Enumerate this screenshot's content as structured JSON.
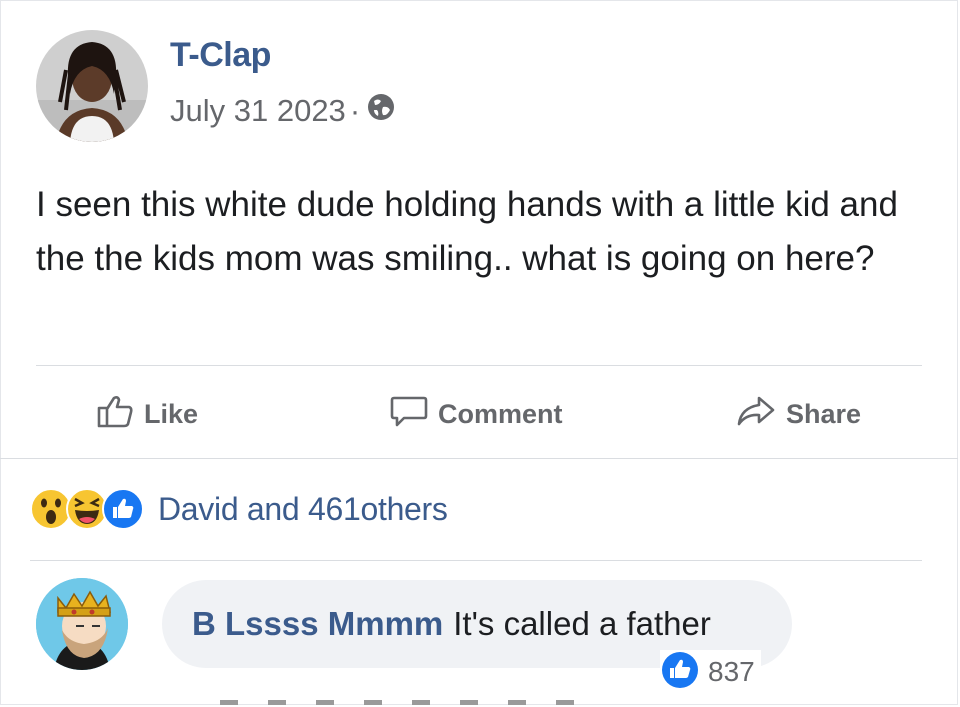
{
  "post": {
    "author": "T-Clap",
    "date": "July 31 2023",
    "separator": "·",
    "privacy_icon": "globe-icon",
    "text": "I seen this white dude holding hands with a little kid and the the kids mom was smiling.. what is going on here?"
  },
  "actions": {
    "like": "Like",
    "comment": "Comment",
    "share": "Share"
  },
  "reactions": {
    "icons": [
      "wow-emoji",
      "haha-emoji",
      "like-icon"
    ],
    "summary": "David and 461others"
  },
  "comment": {
    "author": "B Lssss Mmmm",
    "text": "It's called a father",
    "like_count": "837"
  },
  "colors": {
    "name_blue": "#3b5b8c",
    "muted": "#65676b",
    "like_blue": "#1877f2",
    "bubble": "#f0f2f5",
    "emoji_yellow": "#f7c531"
  }
}
